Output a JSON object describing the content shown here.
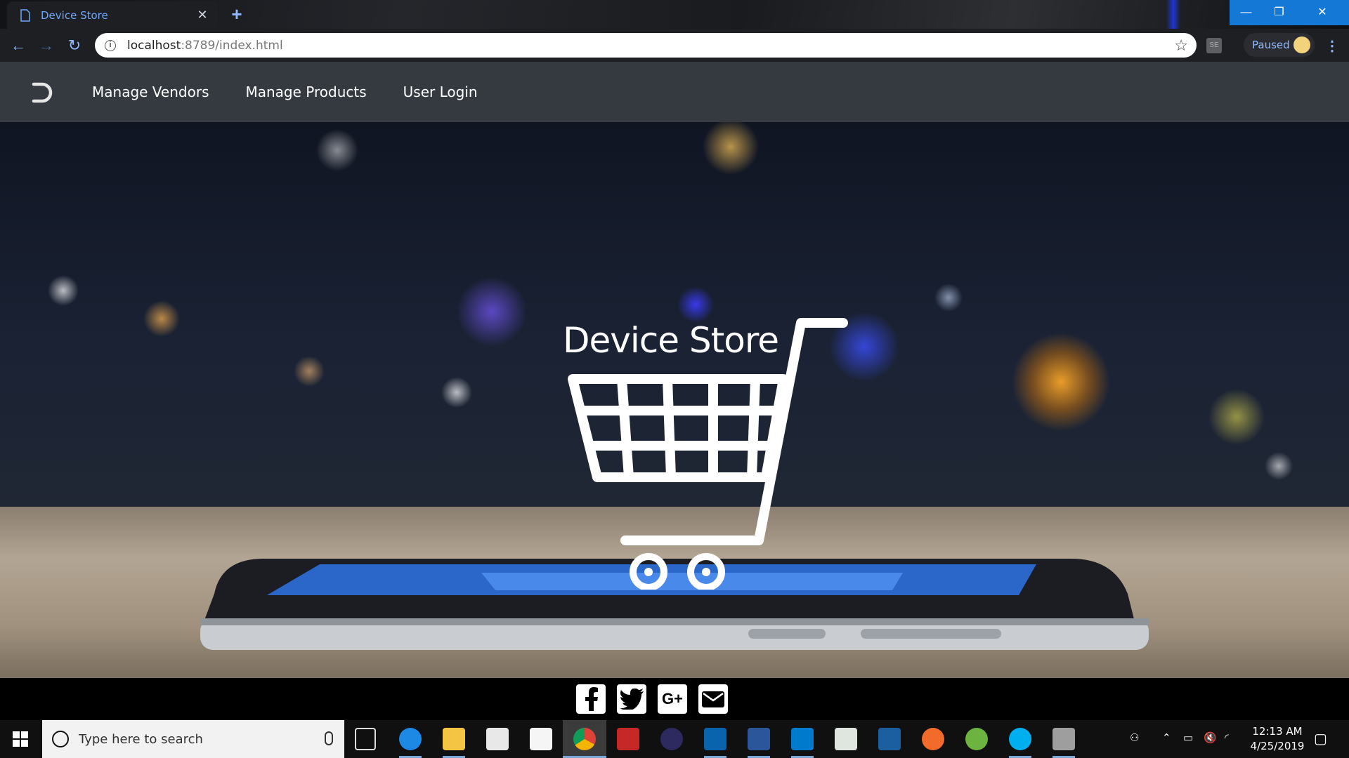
{
  "browser": {
    "tab_title": "Device Store",
    "url_host": "localhost",
    "url_rest": ":8789/index.html",
    "profile_label": "Paused"
  },
  "navbar": {
    "links": [
      "Manage Vendors",
      "Manage Products",
      "User Login"
    ]
  },
  "hero": {
    "title": "Device Store"
  },
  "footer": {
    "social_icons": [
      "facebook-icon",
      "twitter-icon",
      "google-plus-icon",
      "mail-icon"
    ]
  },
  "taskbar": {
    "search_placeholder": "Type here to search",
    "time": "12:13 AM",
    "date": "4/25/2019"
  },
  "colors": {
    "navbar": "#343a40",
    "accent_blue": "#1479d6",
    "tab_text": "#6ea8ff"
  }
}
